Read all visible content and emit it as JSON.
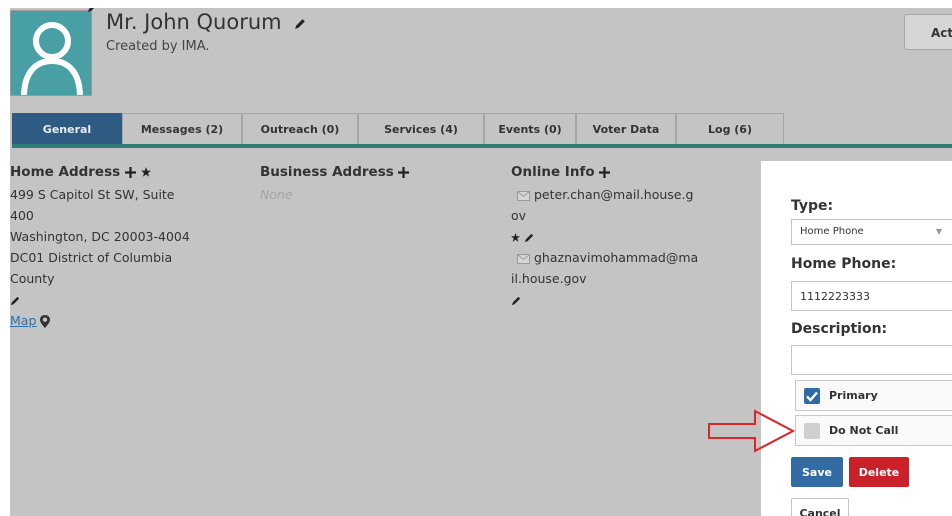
{
  "contact": {
    "name": "Mr. John Quorum",
    "created_by": "Created by IMA."
  },
  "header": {
    "actions_label": "Actions"
  },
  "tabs": [
    {
      "label": "General",
      "active": true
    },
    {
      "label": "Messages (2)"
    },
    {
      "label": "Outreach (0)"
    },
    {
      "label": "Services (4)"
    },
    {
      "label": "Events (0)"
    },
    {
      "label": "Voter Data"
    },
    {
      "label": "Log (6)"
    }
  ],
  "home_address": {
    "title": "Home Address",
    "line1": "499 S Capitol St SW, Suite",
    "line2": "400",
    "line3": "Washington, DC 20003-4004",
    "line4": "DC01 District of Columbia",
    "line5": "County",
    "map_label": "Map"
  },
  "business_address": {
    "title": "Business Address",
    "empty": "None"
  },
  "online_info": {
    "title": "Online Info",
    "email1_a": "peter.chan@mail.house.g",
    "email1_b": "ov",
    "email2_a": "ghaznavimohammad@ma",
    "email2_b": "il.house.gov"
  },
  "phone_panel": {
    "type_label": "Type:",
    "type_value": "Home Phone",
    "number_label": "Home Phone:",
    "number_value": "1112223333",
    "description_label": "Description:",
    "description_value": "",
    "primary_label": "Primary",
    "primary_checked": true,
    "do_not_call_label": "Do Not Call",
    "do_not_call_checked": false,
    "save_label": "Save",
    "delete_label": "Delete",
    "cancel_label": "Cancel"
  },
  "colors": {
    "tab_active": "#2f5b82",
    "tab_rule": "#2e7e76",
    "save": "#336ba3",
    "delete": "#c9202a",
    "annotation_arrow": "#d9262b"
  },
  "icons": {
    "edit": "pencil-icon",
    "add": "plus-icon",
    "star": "star-icon",
    "map": "map-marker-icon",
    "email": "envelope-icon"
  }
}
